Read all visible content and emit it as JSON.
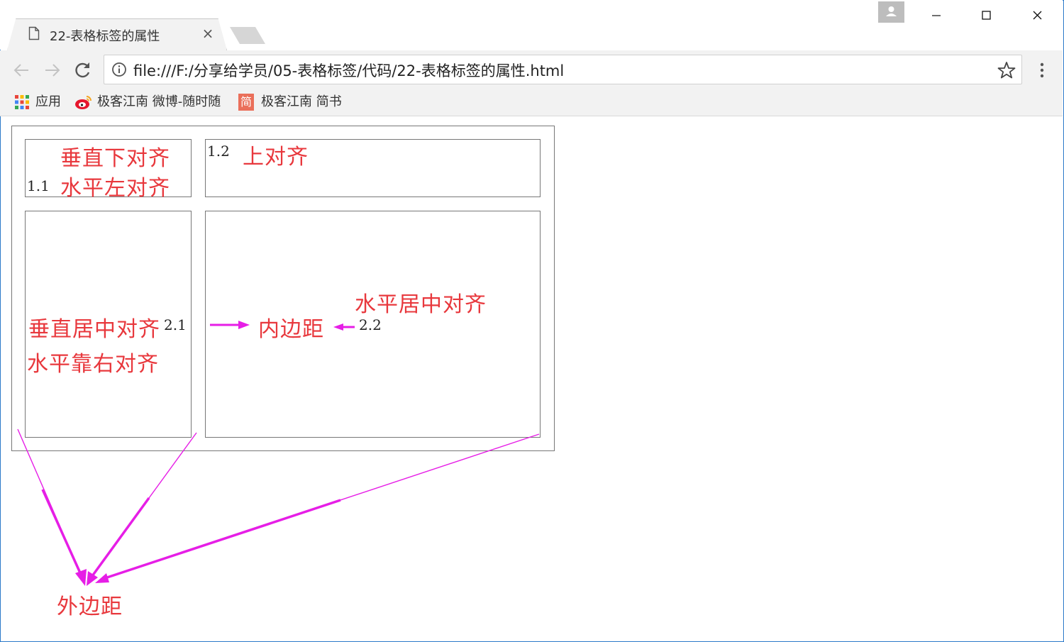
{
  "browser": {
    "tab_title": "22-表格标签的属性",
    "tab_close": "×",
    "url": "file:///F:/分享给学员/05-表格标签/代码/22-表格标签的属性.html",
    "bookmarks": [
      {
        "label": "应用",
        "icon": "apps-grid-icon"
      },
      {
        "label": "极客江南 微博-随时随",
        "icon": "weibo-icon"
      },
      {
        "label": "极客江南 简书",
        "icon": "jianshu-icon",
        "icon_text": "简"
      }
    ],
    "accent_color": "#2b79c9"
  },
  "page": {
    "cells": {
      "c11": {
        "text": "1.1",
        "align": "left",
        "valign": "bottom"
      },
      "c12": {
        "text": "1.2",
        "align": "left",
        "valign": "top"
      },
      "c21": {
        "text": "2.1",
        "align": "right",
        "valign": "middle"
      },
      "c22": {
        "text": "2.2",
        "align": "center",
        "valign": "middle"
      }
    },
    "annotations": {
      "c11_line1": "垂直下对齐",
      "c11_line2": "水平左对齐",
      "c12": "上对齐",
      "c21_line1": "垂直居中对齐",
      "c21_line2": "水平靠右对齐",
      "c22_padding": "内边距",
      "c22_center": "水平居中对齐",
      "margin": "外边距"
    },
    "annotation_color": "#e8383d",
    "arrow_color": "#e61ee6"
  }
}
